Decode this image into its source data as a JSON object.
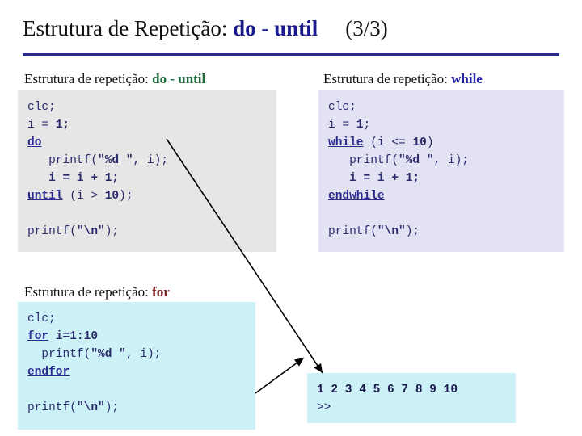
{
  "slide": {
    "title_prefix": "Estrutura de Repetição: ",
    "title_keyword": "do - until",
    "title_number": "(3/3)"
  },
  "blocks": [
    {
      "id": "do-until",
      "heading_prefix": "Estrutura de repetição: ",
      "heading_keyword": "do - until",
      "code_lines": [
        "clc;",
        "i = 1;",
        "do",
        "   printf(\"%d \", i);",
        "   i = i + 1;",
        "until (i > 10);",
        "",
        "printf(\"\\n\");"
      ]
    },
    {
      "id": "while",
      "heading_prefix": "Estrutura de repetição: ",
      "heading_keyword": "while",
      "code_lines": [
        "clc;",
        "i = 1;",
        "while (i <= 10)",
        "   printf(\"%d \", i);",
        "   i = i + 1;",
        "endwhile",
        "",
        "printf(\"\\n\");"
      ]
    },
    {
      "id": "for",
      "heading_prefix": "Estrutura de repetição: ",
      "heading_keyword": "for",
      "code_lines": [
        "clc;",
        "for i=1:10",
        "  printf(\"%d \", i);",
        "endfor",
        "",
        "printf(\"\\n\");"
      ]
    }
  ],
  "output": {
    "line1": "1 2 3 4 5 6 7 8 9 10",
    "line2": ">>"
  },
  "colors": {
    "title_keyword": "#1a1a8c",
    "rule": "#2b2b8f",
    "code_text": "#2b2b6b",
    "box_gray": "#e6e6e6",
    "box_lavender": "#e2e2f2",
    "box_cyan": "#ccf2f7",
    "heading_green": "#1f6b3b",
    "heading_blue": "#2222aa",
    "heading_red": "#7a1f1f"
  }
}
